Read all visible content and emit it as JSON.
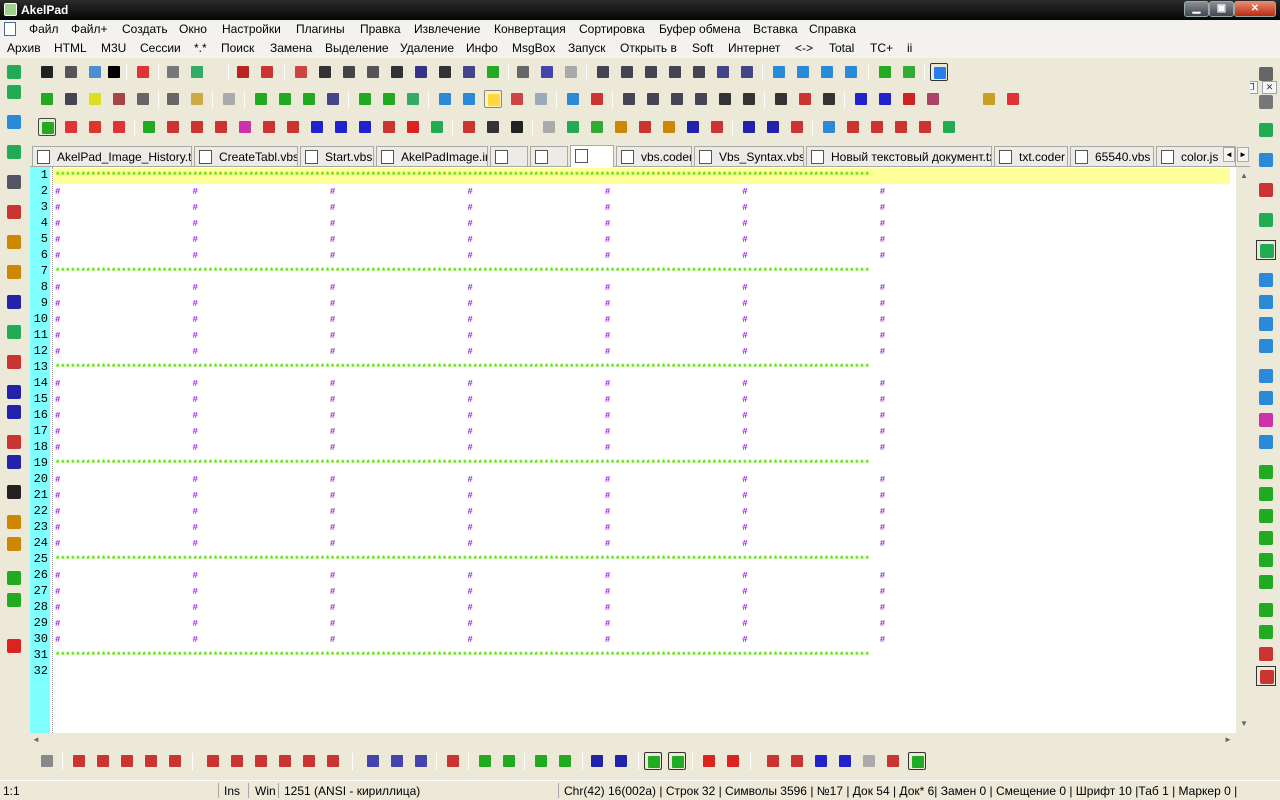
{
  "window": {
    "title": "AkelPad"
  },
  "menu_row1": [
    "Файл",
    "Файл+",
    "Создать",
    "Окно",
    "Настройки",
    "Плагины",
    "Правка",
    "Извлечение",
    "Конвертация",
    "Сортировка",
    "Буфер обмена",
    "Вставка",
    "Справка"
  ],
  "menu_row2": [
    "Архив",
    "HTML",
    "M3U",
    "Сессии",
    "*.*",
    "Поиск",
    "Замена",
    "Выделение",
    "Удаление",
    "Инфо",
    "MsgBox",
    "Запуск",
    "Открыть в",
    "Soft",
    "Интернет",
    "<->",
    "Total",
    "TC+",
    "ii"
  ],
  "tabs": [
    {
      "label": "AkelPad_Image_History.txt",
      "icon": "txt-file-icon"
    },
    {
      "label": "CreateTabl.vbs",
      "icon": "vbs-file-icon"
    },
    {
      "label": "Start.vbs",
      "icon": "vbs-file-icon"
    },
    {
      "label": "AkelPadImage.ini",
      "icon": "ini-file-icon"
    },
    {
      "label": "",
      "icon": "blank-file-icon"
    },
    {
      "label": "",
      "icon": "blank-file-icon"
    },
    {
      "label": "",
      "icon": "blank-file-icon"
    },
    {
      "label": "vbs.coder",
      "icon": "coder-file-icon"
    },
    {
      "label": "Vbs_Syntax.vbs",
      "icon": "vbs-file-icon"
    },
    {
      "label": "Новый текстовый документ.txt",
      "icon": "txt-file-icon"
    },
    {
      "label": "txt.coder",
      "icon": "coder-file-icon"
    },
    {
      "label": "65540.vbs",
      "icon": "vbs-file-icon"
    },
    {
      "label": "color.js",
      "icon": "js-file-icon"
    }
  ],
  "active_tab": 6,
  "editor": {
    "line_numbers": [
      "1",
      "2",
      "3",
      "4",
      "5",
      "6",
      "7",
      "8",
      "9",
      "10",
      "11",
      "12",
      "13",
      "14",
      "15",
      "16",
      "17",
      "18",
      "19",
      "20",
      "21",
      "22",
      "23",
      "24",
      "25",
      "26",
      "27",
      "28",
      "29",
      "30",
      "31",
      "32"
    ],
    "current_line": 1,
    "star_lines": [
      1,
      7,
      13,
      19,
      25,
      31
    ],
    "star_row": "****************************************************************************************************************************************************************",
    "hash_row": "#                          #                          #                          #                          #                          #                          #",
    "star_color": "#55dd00",
    "hash_color": "#a020f0",
    "gutter_color": "#80ffff",
    "current_line_color": "#ffff99"
  },
  "status": {
    "position": "1:1",
    "insert_mode": "Ins",
    "newline": "Win",
    "codepage": "1251  (ANSI - кириллица)",
    "info": "Chr(42) 16(002a) | Строк 32 | Символы 3596 | №17 | Док 54 | Док* 6| Замен 0 | Смещение 0 | Шрифт 10 |Таб 1 | Маркер 0 |"
  }
}
